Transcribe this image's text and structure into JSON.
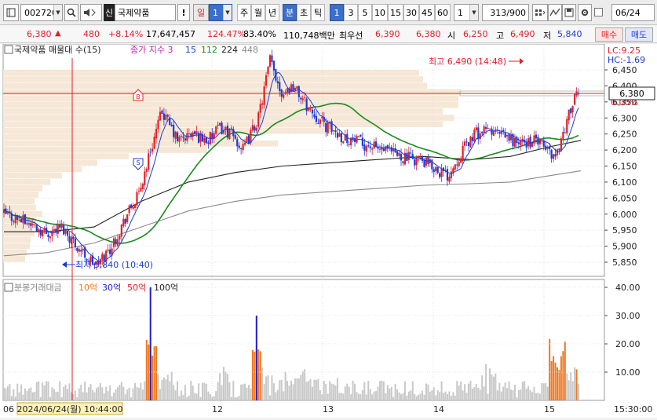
{
  "toolbar": {
    "code": "002720",
    "market_badge": "신",
    "stock_name": "국제약품",
    "exclaim": "!",
    "period_day": "일",
    "period_count": "1",
    "periods": [
      "주",
      "월",
      "년"
    ],
    "unit_min": "분",
    "unit_sec": "초",
    "unit_tick": "틱",
    "minute_options": [
      "1",
      "3",
      "5",
      "10",
      "15",
      "30",
      "45",
      "60"
    ],
    "minute_selected": "1",
    "custom_interval": "1",
    "view_count": "313",
    "view_total": "/900",
    "date": "06/24"
  },
  "quote": {
    "price": "6,380",
    "change": "480",
    "change_pct": "+8.14%",
    "volume": "17,647,457",
    "volume_ratio": "124.47%",
    "strength": "83.40%",
    "amount": "110,748백만",
    "best_bid_label": "최우선",
    "ask": "6,390",
    "bid": "6,380",
    "open_label": "시",
    "open": "6,250",
    "high_label": "고",
    "high": "6,490",
    "low_label": "저",
    "low": "5,840",
    "buy_btn": "매수",
    "sell_btn": "매도"
  },
  "price_panel": {
    "legend_title": "국제약품 매물대 수(15)",
    "ma_label": "종가 지수 3",
    "ma_values": [
      "15",
      "112",
      "224",
      "448"
    ],
    "lc_label": "LC:9.25",
    "hc_label": "HC:-1.69",
    "pct_label": "0.00%",
    "current_price_tag": "6,380",
    "high_annotation": "최고 6,490 (14:48)",
    "low_annotation": "최저 5,840 (10:40)"
  },
  "volume_panel": {
    "legend_title": "분봉거래대금",
    "legend_items": [
      "10억",
      "30억",
      "50억",
      "100억"
    ]
  },
  "x_axis": {
    "start_label": "06",
    "cursor_datetime": "2024/06/24(월) 10:44:00",
    "date_labels": [
      "12",
      "13",
      "14",
      "15"
    ],
    "end_label": "15:30:00"
  },
  "colors": {
    "up": "#e0202a",
    "down": "#1d3bd6",
    "ma15": "#1d3bd6",
    "ma112": "#1b8a1b",
    "ma224": "#222222",
    "ma448": "#8a8a8a",
    "volume_profile": "#f6e7d6",
    "volume_bar": "#c8c8c8",
    "vol_30": "#1d1dc8",
    "vol_50": "#f07820"
  },
  "chart_data": {
    "type": "candlestick",
    "y_axis_price": {
      "min": 5850,
      "max": 6450,
      "ticks": [
        "6,450",
        "6,400",
        "6,350",
        "6,300",
        "6,250",
        "6,200",
        "6,150",
        "6,100",
        "6,050",
        "6,000",
        "5,950",
        "5,900",
        "5,850"
      ]
    },
    "y_axis_amount": {
      "ticks": [
        "40.00",
        "30.00",
        "20.00",
        "10.00"
      ],
      "unit": "억"
    },
    "session_high": 6490,
    "session_low": 5840,
    "current_price": 6380,
    "sessions": [
      {
        "start": 6000,
        "end": 6120,
        "trend": "up"
      },
      {
        "start": 6120,
        "end": 6380,
        "trend": "up"
      },
      {
        "start": 6380,
        "end": 6180,
        "trend": "down"
      },
      {
        "start": 6180,
        "end": 6230,
        "trend": "flat"
      },
      {
        "start": 6230,
        "end": 6150,
        "trend": "down"
      },
      {
        "start": 6150,
        "end": 6380,
        "trend": "up"
      }
    ]
  }
}
